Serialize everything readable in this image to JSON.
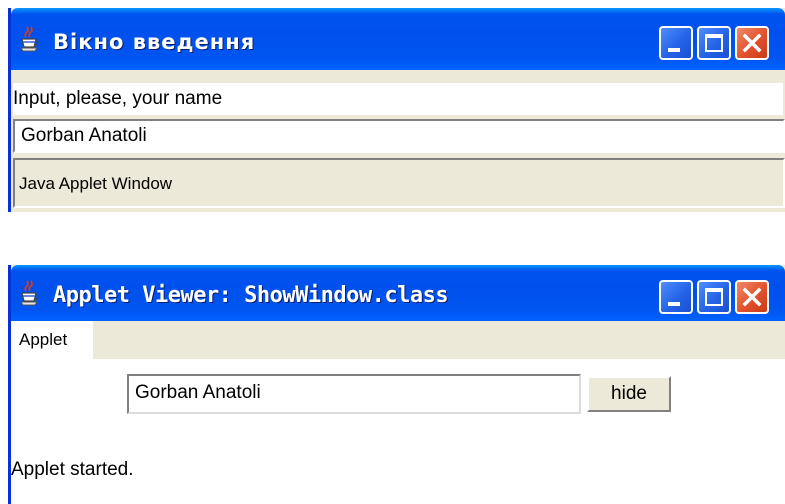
{
  "input_window": {
    "title": "Вікно введення",
    "prompt_label": "Input, please, your name",
    "name_field_value": "Gorban Anatoli",
    "warning_banner": "Java Applet Window",
    "icon": "java-cup-icon"
  },
  "applet_viewer": {
    "title": "Applet Viewer: ShowWindow.class",
    "menu": {
      "applet_label": "Applet"
    },
    "name_field_value": "Gorban Anatoli",
    "hide_button_label": "hide",
    "status_text": "Applet started.",
    "icon": "java-cup-icon"
  },
  "titlebar_buttons": [
    "minimize-icon",
    "maximize-icon",
    "close-icon"
  ],
  "colors": {
    "titlebar": "#0055EA",
    "window_frame": "#0831D9",
    "close_button": "#E2512C",
    "window_background": "#ECE9D8"
  }
}
